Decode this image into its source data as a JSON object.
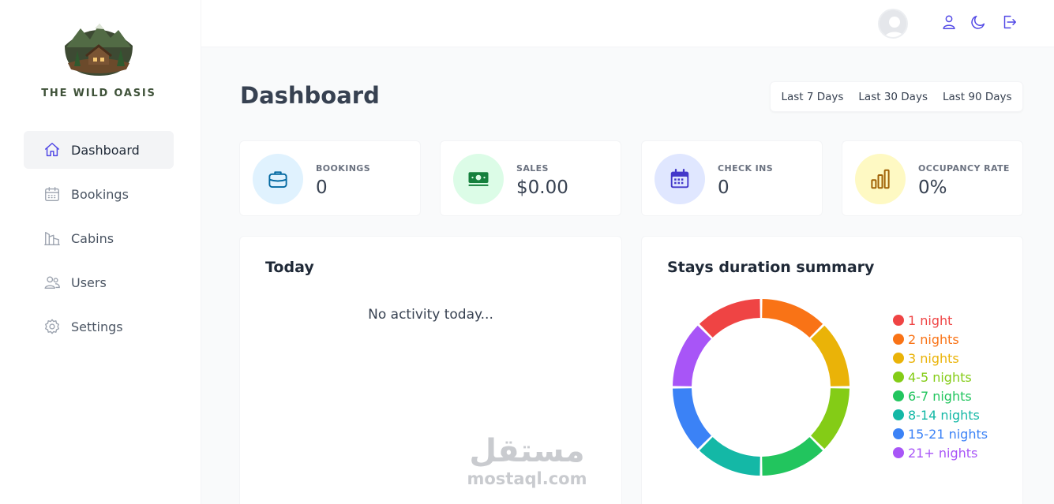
{
  "brand": {
    "name": "THE WILD OASIS"
  },
  "sidebar": {
    "items": [
      {
        "label": "Dashboard",
        "icon": "home-icon",
        "active": true
      },
      {
        "label": "Bookings",
        "icon": "calendar-icon"
      },
      {
        "label": "Cabins",
        "icon": "cabin-icon"
      },
      {
        "label": "Users",
        "icon": "users-icon"
      },
      {
        "label": "Settings",
        "icon": "gear-icon"
      }
    ]
  },
  "header": {
    "icons": [
      "user-icon",
      "moon-icon",
      "logout-icon"
    ]
  },
  "main": {
    "title": "Dashboard",
    "filters": [
      "Last 7 Days",
      "Last 30 Days",
      "Last 90 Days"
    ],
    "stats": [
      {
        "label": "BOOKINGS",
        "value": "0",
        "icon": "briefcase-icon",
        "bg": "#e0f2fe",
        "color": "#0369a1"
      },
      {
        "label": "SALES",
        "value": "$0.00",
        "icon": "banknotes-icon",
        "bg": "#dcfce7",
        "color": "#15803d"
      },
      {
        "label": "CHECK INS",
        "value": "0",
        "icon": "calendar-days-icon",
        "bg": "#e0e7ff",
        "color": "#4338ca"
      },
      {
        "label": "OCCUPANCY RATE",
        "value": "0%",
        "icon": "chart-bar-icon",
        "bg": "#fef9c3",
        "color": "#a16207"
      }
    ],
    "today": {
      "title": "Today",
      "empty": "No activity today..."
    },
    "durations": {
      "title": "Stays duration summary",
      "legend": [
        {
          "label": "1 night",
          "color": "#ef4444"
        },
        {
          "label": "2 nights",
          "color": "#f97316"
        },
        {
          "label": "3 nights",
          "color": "#eab308"
        },
        {
          "label": "4-5 nights",
          "color": "#84cc16"
        },
        {
          "label": "6-7 nights",
          "color": "#22c55e"
        },
        {
          "label": "8-14 nights",
          "color": "#14b8a6"
        },
        {
          "label": "15-21 nights",
          "color": "#3b82f6"
        },
        {
          "label": "21+ nights",
          "color": "#a855f7"
        }
      ]
    }
  },
  "watermark": {
    "arabic": "مستقل",
    "latin": "mostaql.com"
  }
}
